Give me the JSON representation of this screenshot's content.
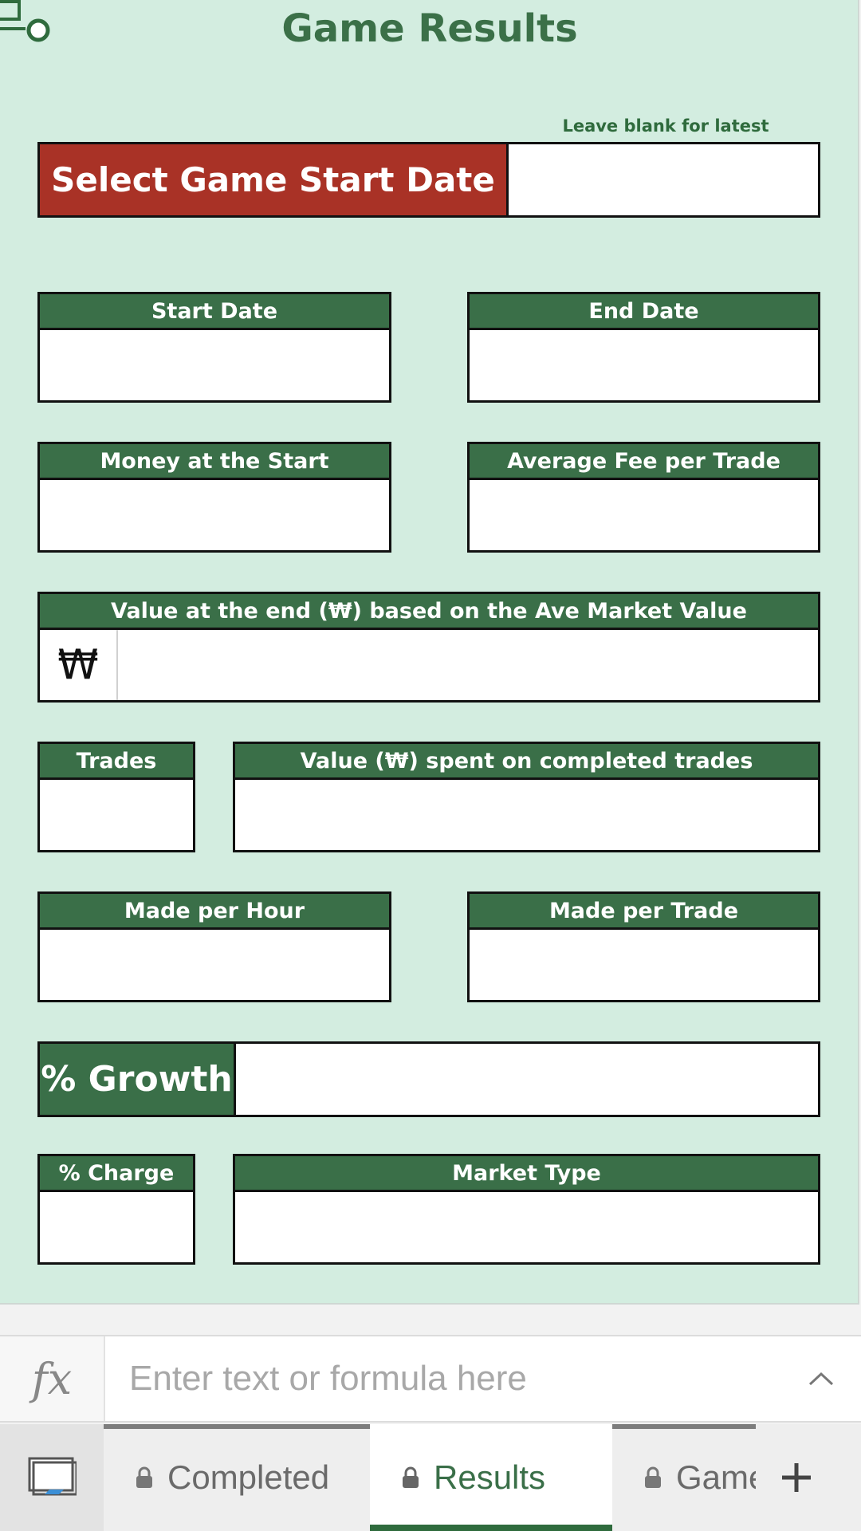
{
  "sheet": {
    "title": "Game Results",
    "note": "Leave blank for latest",
    "select_label": "Select Game Start Date",
    "fields": {
      "start_date": "Start Date",
      "end_date": "End Date",
      "money_start": "Money at the Start",
      "avg_fee": "Average Fee per Trade",
      "value_end": "Value at the end (₩) based on the Ave Market Value",
      "won_symbol": "₩",
      "trades": "Trades",
      "value_spent": "Value (₩) spent on completed trades",
      "made_hour": "Made per Hour",
      "made_trade": "Made per Trade",
      "growth": "% Growth",
      "charge": "% Charge",
      "market_type": "Market Type"
    }
  },
  "formula_bar": {
    "icon": "function-icon",
    "placeholder": "Enter text or formula here"
  },
  "tabs": [
    {
      "label": "Completed",
      "locked": true,
      "active": false
    },
    {
      "label": "Results",
      "locked": true,
      "active": true
    },
    {
      "label": "Game",
      "locked": true,
      "active": false
    }
  ],
  "colors": {
    "sheet_bg": "#d3ede0",
    "header_green": "#3a6f48",
    "select_red": "#a93226",
    "title_green": "#3b7048"
  }
}
